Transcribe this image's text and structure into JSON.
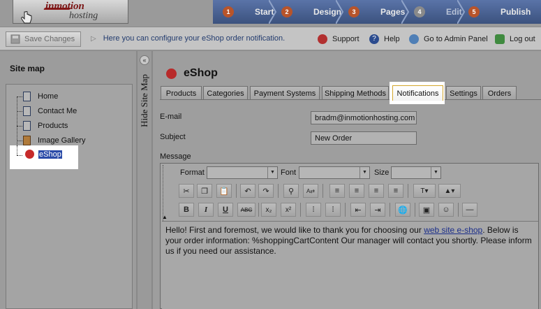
{
  "logo": {
    "text1": "inmotion",
    "text2": "hosting"
  },
  "steps": [
    {
      "num": "1",
      "label": "Start"
    },
    {
      "num": "2",
      "label": "Design"
    },
    {
      "num": "3",
      "label": "Pages"
    },
    {
      "num": "4",
      "label": "Edit"
    },
    {
      "num": "5",
      "label": "Publish"
    }
  ],
  "toolbar": {
    "save_label": "Save Changes",
    "hint": "Here you can configure your eShop order notification.",
    "support": "Support",
    "help": "Help",
    "admin": "Go to Admin Panel",
    "logout": "Log out"
  },
  "sidebar": {
    "title": "Site map",
    "items": [
      "Home",
      "Contact Me",
      "Products",
      "Image Gallery",
      "eShop"
    ],
    "collapse_glyph": "«",
    "hide_label": "Hide Site Map"
  },
  "page": {
    "title": "eShop",
    "tabs": [
      "Products",
      "Categories",
      "Payment Systems",
      "Shipping Methods",
      "Notifications",
      "Settings",
      "Orders"
    ],
    "active_tab": "Notifications"
  },
  "form": {
    "email_label": "E-mail",
    "email_value": "bradm@inmotionhosting.com",
    "subject_label": "Subject",
    "subject_value": "New Order",
    "message_label": "Message"
  },
  "editor": {
    "format_label": "Format",
    "font_label": "Font",
    "size_label": "Size",
    "message_before": "Hello! First and foremost, we would like to thank you for choosing our ",
    "message_link": "web site e-shop",
    "message_after": ". Below is your order information: %shoppingCartContent Our manager will contact you shortly. Please inform us if you need our assistance."
  },
  "colors": {
    "accent": "#d4a72c",
    "steps_bg": "#3b527e",
    "selected": "#2a4ba8"
  }
}
